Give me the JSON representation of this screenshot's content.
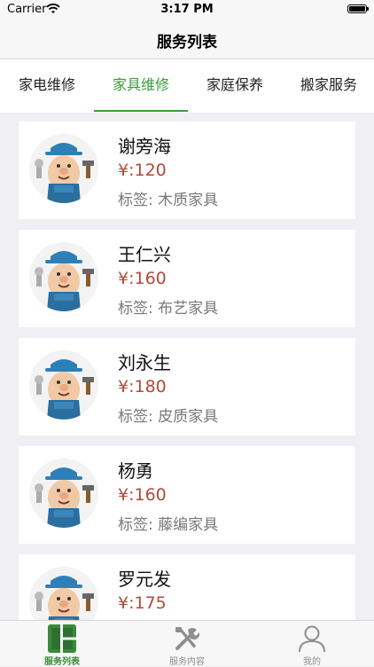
{
  "status_bar": {
    "carrier": "Carrier",
    "time": "3:17 PM"
  },
  "nav": {
    "title": "服务列表"
  },
  "tabs": [
    {
      "label": "家电维修"
    },
    {
      "label": "家具维修"
    },
    {
      "label": "家庭保养"
    },
    {
      "label": "搬家服务"
    }
  ],
  "active_tab": "家具维修",
  "providers": [
    {
      "name": "谢旁海",
      "price": "¥:120",
      "tag": "标签: 木质家具"
    },
    {
      "name": "王仁兴",
      "price": "¥:160",
      "tag": "标签: 布艺家具"
    },
    {
      "name": "刘永生",
      "price": "¥:180",
      "tag": "标签: 皮质家具"
    },
    {
      "name": "杨勇",
      "price": "¥:160",
      "tag": "标签: 藤编家具"
    },
    {
      "name": "罗元发",
      "price": "¥:175",
      "tag": ""
    }
  ],
  "tab_bar": [
    {
      "label": "服务列表",
      "icon": "grid-icon"
    },
    {
      "label": "服务内容",
      "icon": "tools-icon"
    },
    {
      "label": "我的",
      "icon": "user-icon"
    }
  ],
  "colors": {
    "accent": "#3a9a3a",
    "price": "#b04a3a"
  }
}
